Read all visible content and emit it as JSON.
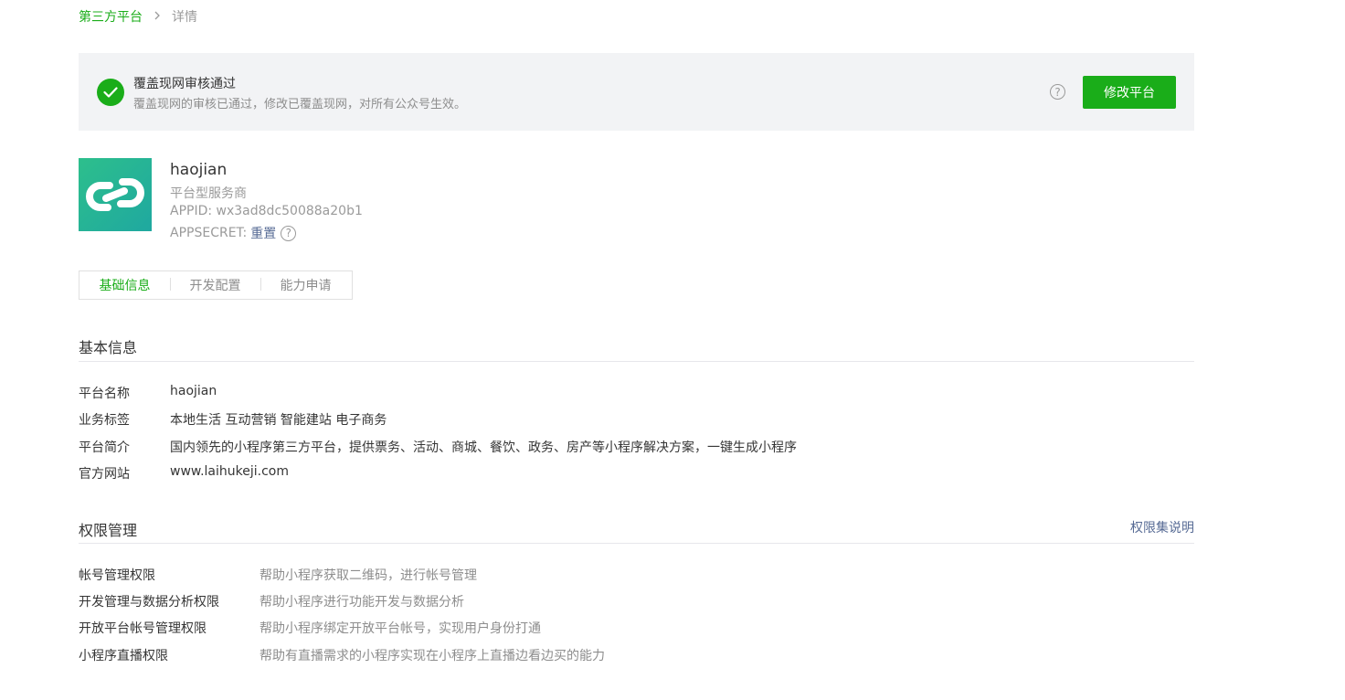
{
  "breadcrumb": {
    "parent": "第三方平台",
    "separator": ">",
    "current": "详情"
  },
  "notice": {
    "title": "覆盖现网审核通过",
    "description": "覆盖现网的审核已通过，修改已覆盖现网，对所有公众号生效。",
    "help_symbol": "?",
    "button_label": "修改平台"
  },
  "profile": {
    "name": "haojian",
    "type": "平台型服务商",
    "appid": "APPID: wx3ad8dc50088a20b1",
    "secret_label": "APPSECRET:",
    "secret_action": "重置",
    "help_symbol": "?"
  },
  "tabs": [
    {
      "label": "基础信息",
      "active": true
    },
    {
      "label": "开发配置",
      "active": false
    },
    {
      "label": "能力申请",
      "active": false
    }
  ],
  "basic_info": {
    "title": "基本信息",
    "rows": [
      {
        "label": "平台名称",
        "value": "haojian"
      },
      {
        "label": "业务标签",
        "value": "本地生活 互动营销 智能建站 电子商务"
      },
      {
        "label": "平台简介",
        "value": "国内领先的小程序第三方平台，提供票务、活动、商城、餐饮、政务、房产等小程序解决方案，一键生成小程序"
      },
      {
        "label": "官方网站",
        "value": "www.laihukeji.com"
      }
    ]
  },
  "permissions": {
    "title": "权限管理",
    "link": "权限集说明",
    "rows": [
      {
        "label": "帐号管理权限",
        "desc": "帮助小程序获取二维码，进行帐号管理"
      },
      {
        "label": "开发管理与数据分析权限",
        "desc": "帮助小程序进行功能开发与数据分析"
      },
      {
        "label": "开放平台帐号管理权限",
        "desc": "帮助小程序绑定开放平台帐号，实现用户身份打通"
      },
      {
        "label": "小程序直播权限",
        "desc": "帮助有直播需求的小程序实现在小程序上直播边看边买的能力"
      }
    ]
  },
  "colors": {
    "accent_green": "#1aad19",
    "link_blue": "#576b95",
    "notice_bg": "#f2f3f5"
  },
  "icons": {
    "success": "check-circle-icon",
    "help": "question-circle-icon",
    "logo": "chain-link-logo"
  }
}
